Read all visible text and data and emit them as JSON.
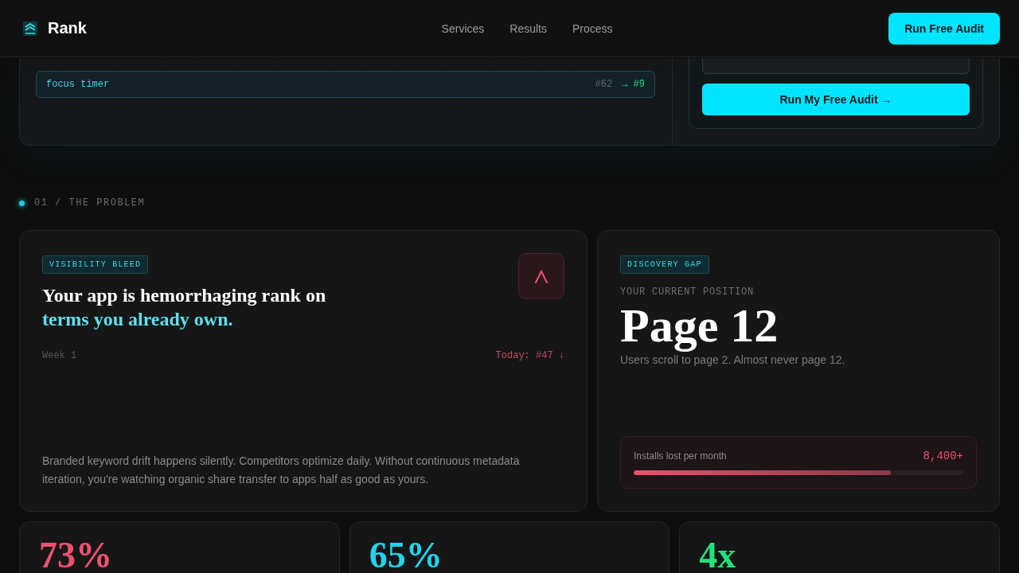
{
  "header": {
    "logo": "Rank",
    "nav": [
      {
        "label": "Services"
      },
      {
        "label": "Results"
      },
      {
        "label": "Process"
      }
    ],
    "cta": "Run Free Audit"
  },
  "hero": {
    "keyword": {
      "term": "focus timer",
      "from": "#62",
      "to": "→ #9"
    },
    "audit": {
      "button": "Run My Free Audit →"
    }
  },
  "section": {
    "label": "01 / THE PROBLEM"
  },
  "problem": {
    "tag": "VISIBILITY BLEED",
    "heading": "Your app is hemorrhaging rank on *terms you already own.*",
    "start": "Week 1",
    "today": "Today: #47 ↓",
    "body": "Branded keyword drift happens silently. Competitors optimize daily. Without continuous metadata iteration, you're watching organic share transfer to apps half as good as yours."
  },
  "gap": {
    "tag": "DISCOVERY GAP",
    "caption": "YOUR CURRENT POSITION",
    "position": "Page 12",
    "subtitle": "Users scroll to page 2. Almost never page 12.",
    "meter": {
      "label": "Installs lost per month",
      "value": "8,400+",
      "level": 0.78
    }
  },
  "stats": [
    {
      "value": "73%",
      "color": "#f0506e"
    },
    {
      "value": "65%",
      "color": "#22d3ee"
    },
    {
      "value": "4x",
      "color": "#22e07a"
    }
  ]
}
